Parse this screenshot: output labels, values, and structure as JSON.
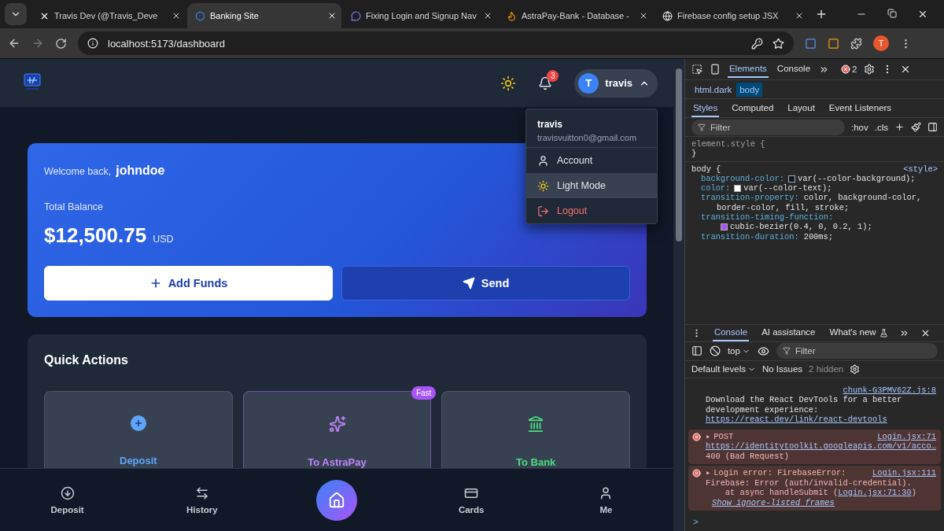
{
  "browser": {
    "tabs": [
      {
        "title": "Travis Dev (@Travis_Deve",
        "selected": false,
        "kind": "x"
      },
      {
        "title": "Banking Site",
        "selected": true,
        "kind": "site"
      },
      {
        "title": "Fixing Login and Signup Nav",
        "selected": false,
        "kind": "chat"
      },
      {
        "title": "AstraPay-Bank - Database - ",
        "selected": false,
        "kind": "fire"
      },
      {
        "title": "Firebase config setup JSX",
        "selected": false,
        "kind": "gpt"
      }
    ],
    "address": "localhost:5173/dashboard",
    "profile_initial": "T"
  },
  "app": {
    "header": {
      "notification_count": "3",
      "user_initial": "T",
      "user_name": "travis",
      "menu_open": true
    },
    "menu": {
      "name": "travis",
      "email": "travisvuitton0@gmail.com",
      "items": [
        {
          "label": "Account",
          "kind": "account",
          "selected": false
        },
        {
          "label": "Light Mode",
          "kind": "theme",
          "selected": true
        },
        {
          "label": "Logout",
          "kind": "logout",
          "selected": false
        }
      ]
    },
    "balance": {
      "welcome": "Welcome back,",
      "username": "johndoe",
      "label": "Total Balance",
      "amount": "$12,500.75",
      "currency": "USD",
      "buttons": [
        {
          "label": "Add Funds",
          "kind": "add"
        },
        {
          "label": "Send",
          "kind": "send"
        }
      ]
    },
    "quick_actions": {
      "title": "Quick Actions",
      "items": [
        {
          "label": "Deposit",
          "kind": "deposit",
          "color": "#60a5fa"
        },
        {
          "label": "To AstraPay",
          "kind": "astrapay",
          "color": "#c084fc",
          "badge": "Fast"
        },
        {
          "label": "To Bank",
          "kind": "bank",
          "color": "#4ade80"
        }
      ]
    },
    "bottom_nav": [
      {
        "label": "Deposit",
        "kind": "deposit",
        "selected": false
      },
      {
        "label": "History",
        "kind": "history",
        "selected": false
      },
      {
        "kind": "home",
        "selected": true
      },
      {
        "label": "Cards",
        "kind": "cards",
        "selected": false
      },
      {
        "label": "Me",
        "kind": "me",
        "selected": false
      }
    ]
  },
  "devtools": {
    "tabs": [
      {
        "label": "Elements",
        "selected": true
      },
      {
        "label": "Console",
        "selected": false
      }
    ],
    "error_count": "2",
    "breadcrumb": [
      {
        "label": "html.dark",
        "selected": false
      },
      {
        "label": "body",
        "selected": true
      }
    ],
    "style_tabs": [
      {
        "label": "Styles",
        "selected": true
      },
      {
        "label": "Computed",
        "selected": false
      },
      {
        "label": "Layout",
        "selected": false
      },
      {
        "label": "Event Listeners",
        "selected": false
      }
    ],
    "filter_placeholder": "Filter",
    "hov": ":hov",
    "cls": ".cls",
    "rules": [
      {
        "selector": "element.style {",
        "close": "}"
      },
      {
        "selector": "body {",
        "source": "<style>",
        "decls": [
          {
            "prop": "background-color:",
            "value": "var(--color-background);",
            "color": "#0f172a"
          },
          {
            "prop": "color:",
            "value": "var(--color-text);",
            "color": "#ffffff"
          },
          {
            "prop": "transition-property:",
            "value": "color, background-color,"
          },
          {
            "cont": "border-color, fill, stroke;"
          },
          {
            "prop": "transition-timing-function:"
          },
          {
            "cont": "cubic-bezier(0.4, 0, 0.2, 1);",
            "color": "#a855f7"
          },
          {
            "prop": "transition-duration:",
            "value": "200ms;"
          }
        ]
      }
    ],
    "drawer_tabs": [
      {
        "label": "Console",
        "selected": true
      },
      {
        "label": "AI assistance",
        "selected": false
      },
      {
        "label": "What's new",
        "selected": false
      }
    ],
    "context": "top",
    "console_filter": "Filter",
    "levels": "Default levels",
    "issues": "No Issues",
    "hidden": "2 hidden",
    "messages": [
      {
        "kind": "info",
        "source": "chunk-G3PMV62Z.js:8",
        "lines": [
          [
            {
              "text": "Download the React DevTools for a better"
            }
          ],
          [
            {
              "text": "development experience:"
            }
          ],
          [
            {
              "text": "https://react.dev/link/react-devtools",
              "link": true
            }
          ]
        ]
      },
      {
        "kind": "error",
        "toggle": "▸",
        "head": "POST",
        "source": "Login.jsx:71",
        "lines": [
          [
            {
              "text": "https://identitytoolkit.googleapis.com/v1/acco…",
              "link": true
            }
          ],
          [
            {
              "text": "400 (Bad Request)"
            }
          ]
        ]
      },
      {
        "kind": "error",
        "toggle": "▸",
        "head": "Login error: FirebaseError:",
        "source": "Login.jsx:111",
        "lines": [
          [
            {
              "text": "Firebase: Error (auth/invalid-credential)."
            }
          ],
          [
            {
              "text": "    at async handleSubmit ("
            },
            {
              "text": "Login.jsx:71:30",
              "link": true
            },
            {
              "text": ")"
            }
          ]
        ],
        "more": "Show ignore-listed frames"
      }
    ],
    "prompt": ">"
  }
}
